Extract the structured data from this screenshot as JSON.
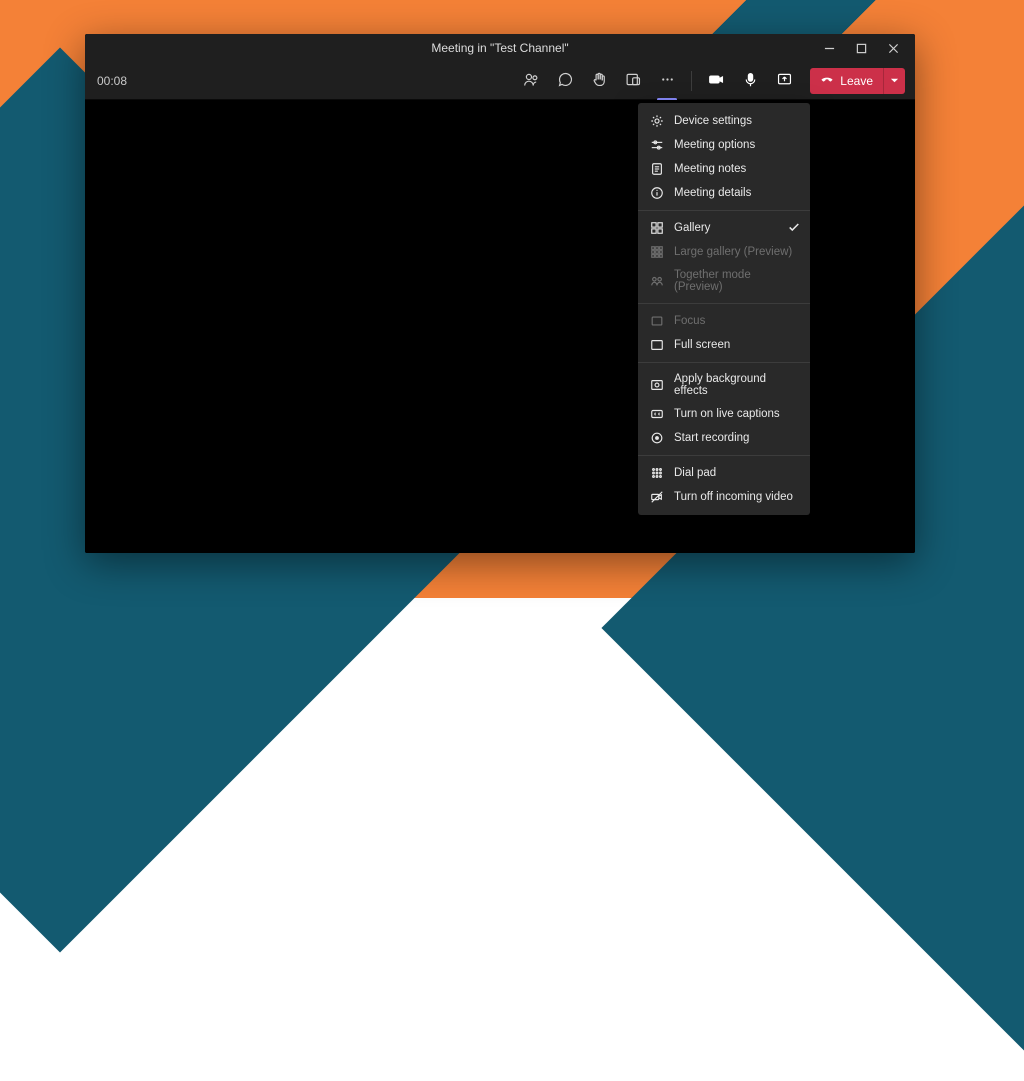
{
  "window": {
    "title": "Meeting in \"Test Channel\""
  },
  "toolbar": {
    "timer": "00:08",
    "leave_label": "Leave"
  },
  "menu": {
    "device_settings": "Device settings",
    "meeting_options": "Meeting options",
    "meeting_notes": "Meeting notes",
    "meeting_details": "Meeting details",
    "gallery": "Gallery",
    "large_gallery": "Large gallery (Preview)",
    "together_mode": "Together mode (Preview)",
    "focus": "Focus",
    "full_screen": "Full screen",
    "background_effects": "Apply background effects",
    "live_captions": "Turn on live captions",
    "start_recording": "Start recording",
    "dial_pad": "Dial pad",
    "incoming_video_off": "Turn off incoming video"
  }
}
